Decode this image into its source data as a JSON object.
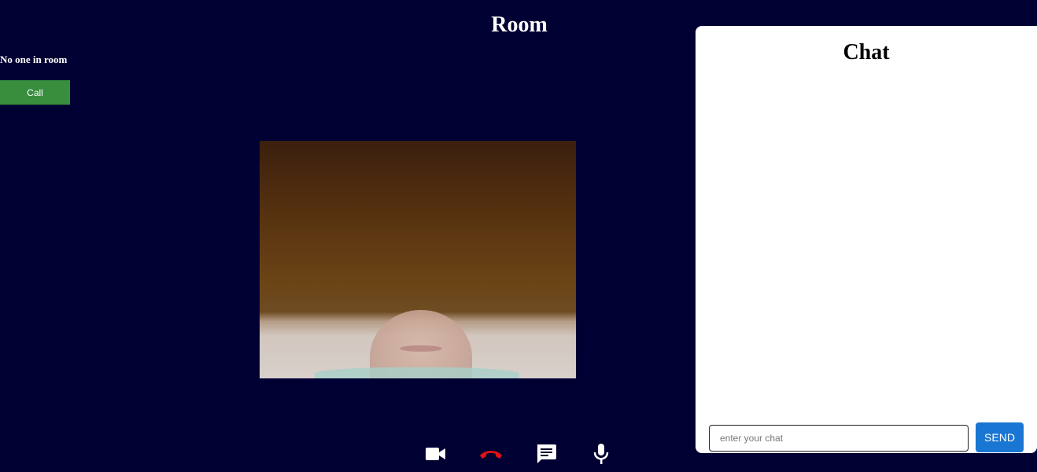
{
  "room": {
    "title": "Room"
  },
  "status": {
    "text": "No one in room"
  },
  "call_button": {
    "label": "Call"
  },
  "controls": [
    {
      "icon": "video-camera-icon",
      "color": "#ffffff"
    },
    {
      "icon": "hang-up-icon",
      "color": "#e01010"
    },
    {
      "icon": "chat-icon",
      "color": "#ffffff"
    },
    {
      "icon": "microphone-icon",
      "color": "#ffffff"
    }
  ],
  "chat": {
    "title": "Chat",
    "input_placeholder": "enter your chat",
    "input_value": "",
    "send_label": "SEND"
  },
  "colors": {
    "background": "#000033",
    "call_button": "#388e3c",
    "send_button": "#1976d2",
    "hangup": "#e01010"
  }
}
